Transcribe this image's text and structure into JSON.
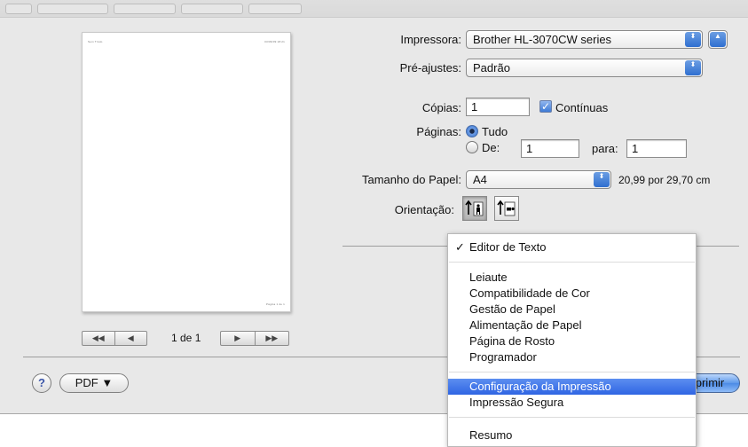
{
  "preview": {
    "header_left": "Sem Título",
    "header_right": "03/06/09 18:21",
    "footer_text": "Página 1 de 1",
    "page_indicator": "1 de 1",
    "first_page_glyph": "◀◀",
    "prev_page_glyph": "◀",
    "next_page_glyph": "▶",
    "last_page_glyph": "▶▶"
  },
  "settings": {
    "printer_label": "Impressora:",
    "printer_value": "Brother HL-3070CW series",
    "presets_label": "Pré-ajustes:",
    "presets_value": "Padrão",
    "copies_label": "Cópias:",
    "copies_value": "1",
    "collated_label": "Contínuas",
    "collated_checked": true,
    "pages_label": "Páginas:",
    "pages_all_label": "Tudo",
    "pages_from_label": "De:",
    "pages_from_value": "1",
    "pages_to_label": "para:",
    "pages_to_value": "1",
    "paper_size_label": "Tamanho do Papel:",
    "paper_size_value": "A4",
    "paper_dimensions": "20,99 por 29,70 cm",
    "orientation_label": "Orientação:"
  },
  "menu": {
    "checked_item": "Editor de Texto",
    "items": [
      "Leiaute",
      "Compatibilidade de Cor",
      "Gestão de Papel",
      "Alimentação de Papel",
      "Página de Rosto",
      "Programador"
    ],
    "highlighted_item": "Configuração da Impressão",
    "secure_item": "Impressão Segura",
    "summary_item": "Resumo",
    "checkmark": "✓"
  },
  "footer": {
    "help_label": "?",
    "pdf_label": "PDF ▼",
    "print_label": "primir"
  },
  "colors": {
    "highlight": "#2f65e3",
    "accent_blue": "#4c8ae6",
    "window_bg": "#e8e8e8"
  },
  "icons": {
    "popup_arrows": "⬍",
    "disclosure": "▲"
  }
}
